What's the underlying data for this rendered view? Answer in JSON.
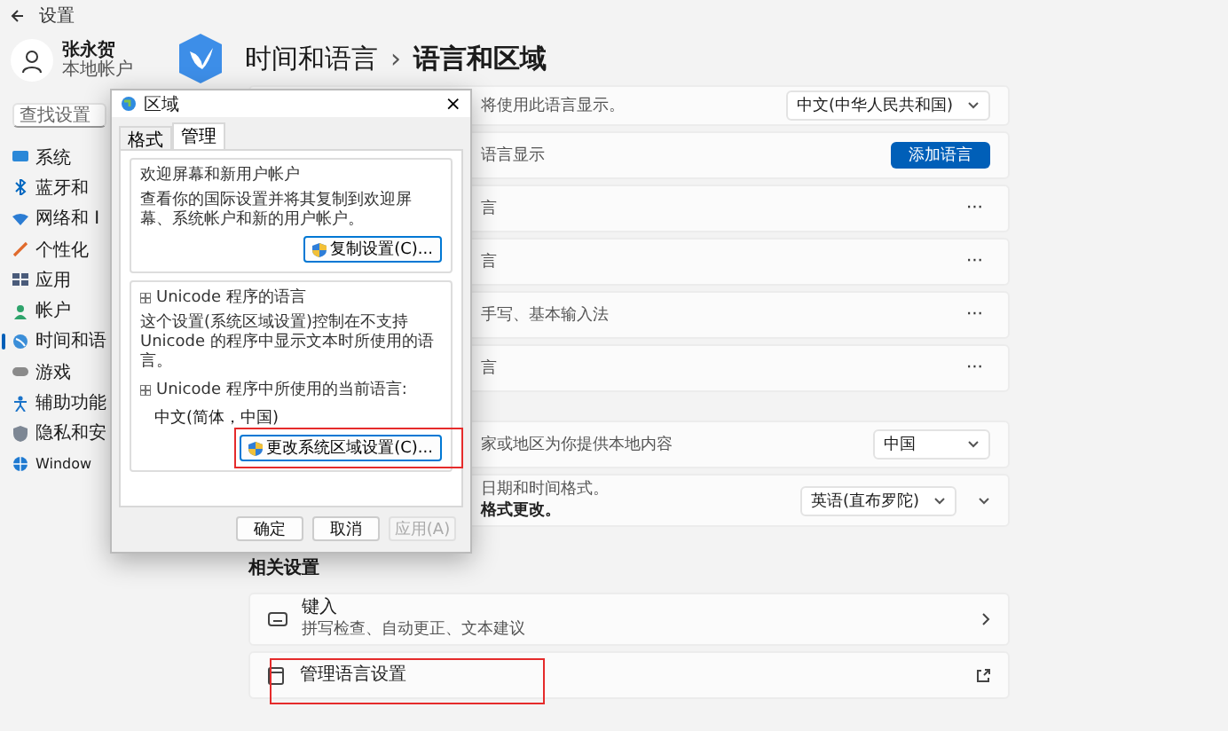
{
  "window": {
    "title": "设置"
  },
  "user": {
    "name": "张永贺",
    "account": "本地帐户"
  },
  "search": {
    "placeholder": "查找设置"
  },
  "nav": [
    {
      "label": "系统",
      "selected": false
    },
    {
      "label": "蓝牙和",
      "selected": false
    },
    {
      "label": "网络和 I",
      "selected": false
    },
    {
      "label": "个性化",
      "selected": false
    },
    {
      "label": "应用",
      "selected": false
    },
    {
      "label": "帐户",
      "selected": false
    },
    {
      "label": "时间和语",
      "selected": true
    },
    {
      "label": "游戏",
      "selected": false
    },
    {
      "label": "辅助功能",
      "selected": false
    },
    {
      "label": "隐私和安",
      "selected": false
    },
    {
      "label": "Window",
      "selected": false
    }
  ],
  "breadcrumb": {
    "parent": "时间和语言",
    "separator": "›",
    "current": "语言和区域"
  },
  "sections": [
    {
      "kind": "covered",
      "cards": [
        {
          "lines": [
            {
              "text": "将使用此语言显示。",
              "emphasis": false
            }
          ],
          "control": {
            "kind": "dropdown",
            "value": "中文(中华人民共和国)"
          }
        },
        {
          "lines": [
            {
              "text": "语言显示",
              "emphasis": false
            }
          ],
          "control": {
            "kind": "button",
            "label": "添加语言"
          }
        },
        {
          "lines": [
            {
              "text": "言",
              "emphasis": false
            }
          ],
          "control": {
            "kind": "more",
            "label": "···"
          }
        },
        {
          "lines": [
            {
              "text": "言",
              "emphasis": false
            }
          ],
          "control": {
            "kind": "more",
            "label": "···"
          }
        },
        {
          "lines": [
            {
              "text": "手写、基本输入法",
              "emphasis": false
            }
          ],
          "control": {
            "kind": "more",
            "label": "···"
          }
        },
        {
          "lines": [
            {
              "text": "言",
              "emphasis": false
            }
          ],
          "control": {
            "kind": "more",
            "label": "···"
          }
        }
      ]
    },
    {
      "kind": "covered",
      "cards": [
        {
          "lines": [
            {
              "text": "家或地区为你提供本地内容",
              "emphasis": false
            }
          ],
          "control": {
            "kind": "dropdown",
            "value": "中国"
          }
        },
        {
          "lines": [
            {
              "text": "日期和时间格式。",
              "emphasis": false
            },
            {
              "text": "格式更改。",
              "emphasis": true
            }
          ],
          "control": {
            "kind": "dropdown",
            "value": "英语(直布罗陀)"
          },
          "expandable": true
        }
      ]
    },
    {
      "kind": "related",
      "title": "相关设置",
      "cards": [
        {
          "title": "键入",
          "lines": [
            {
              "text": "拼写检查、自动更正、文本建议",
              "emphasis": false
            }
          ],
          "control": {
            "kind": "chevron"
          }
        },
        {
          "title": "管理语言设置",
          "control": {
            "kind": "external"
          },
          "highlighted": true
        }
      ]
    }
  ],
  "dialog": {
    "title": "区域",
    "close": "×",
    "tabs": [
      {
        "label": "格式",
        "selected": false
      },
      {
        "label": "管理",
        "selected": true
      }
    ],
    "groups": [
      {
        "title": "欢迎屏幕和新用户帐户",
        "text": "查看你的国际设置并将其复制到欢迎屏幕、系统帐户和新的用户帐户。",
        "button": "复制设置(C)..."
      },
      {
        "title": "Unicode 程序的语言",
        "text": "这个设置(系统区域设置)控制在不支持 Unicode 的程序中显示文本时所使用的语言。",
        "sublabel": "Unicode 程序中所使用的当前语言:",
        "value": "中文(简体，中国)",
        "button": "更改系统区域设置(C)...",
        "highlighted": true
      }
    ],
    "buttons": [
      {
        "label": "确定",
        "disabled": false
      },
      {
        "label": "取消",
        "disabled": false
      },
      {
        "label": "应用(A)",
        "disabled": true
      }
    ]
  }
}
